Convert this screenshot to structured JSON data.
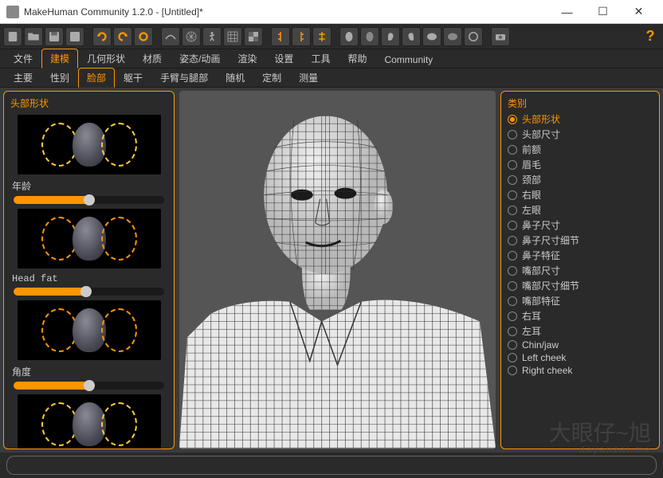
{
  "window": {
    "title": "MakeHuman Community 1.2.0 - [Untitled]*"
  },
  "tabs1": [
    {
      "label": "文件",
      "active": false
    },
    {
      "label": "建模",
      "active": true
    },
    {
      "label": "几何形状",
      "active": false
    },
    {
      "label": "材质",
      "active": false
    },
    {
      "label": "姿态/动画",
      "active": false
    },
    {
      "label": "渲染",
      "active": false
    },
    {
      "label": "设置",
      "active": false
    },
    {
      "label": "工具",
      "active": false
    },
    {
      "label": "帮助",
      "active": false
    },
    {
      "label": "Community",
      "active": false
    }
  ],
  "tabs2": [
    {
      "label": "主要",
      "active": false
    },
    {
      "label": "性别",
      "active": false
    },
    {
      "label": "脸部",
      "active": true
    },
    {
      "label": "躯干",
      "active": false
    },
    {
      "label": "手臂与腿部",
      "active": false
    },
    {
      "label": "随机",
      "active": false
    },
    {
      "label": "定制",
      "active": false
    },
    {
      "label": "测量",
      "active": false
    }
  ],
  "leftPanel": {
    "title": "头部形状",
    "items": [
      {
        "label": "年龄",
        "slider": 50
      },
      {
        "label": "Head fat",
        "slider": 48
      },
      {
        "label": "角度",
        "slider": 50
      }
    ]
  },
  "rightPanel": {
    "title": "类别",
    "options": [
      {
        "label": "头部形状",
        "checked": true
      },
      {
        "label": "头部尺寸",
        "checked": false
      },
      {
        "label": "前额",
        "checked": false
      },
      {
        "label": "眉毛",
        "checked": false
      },
      {
        "label": "颈部",
        "checked": false
      },
      {
        "label": "右眼",
        "checked": false
      },
      {
        "label": "左眼",
        "checked": false
      },
      {
        "label": "鼻子尺寸",
        "checked": false
      },
      {
        "label": "鼻子尺寸细节",
        "checked": false
      },
      {
        "label": "鼻子特征",
        "checked": false
      },
      {
        "label": "嘴部尺寸",
        "checked": false
      },
      {
        "label": "嘴部尺寸细节",
        "checked": false
      },
      {
        "label": "嘴部特征",
        "checked": false
      },
      {
        "label": "右耳",
        "checked": false
      },
      {
        "label": "左耳",
        "checked": false
      },
      {
        "label": "Chin/jaw",
        "checked": false
      },
      {
        "label": "Left cheek",
        "checked": false
      },
      {
        "label": "Right cheek",
        "checked": false
      }
    ]
  },
  "watermark": {
    "main": "大眼仔~旭",
    "sub": "dayanzai.me"
  }
}
